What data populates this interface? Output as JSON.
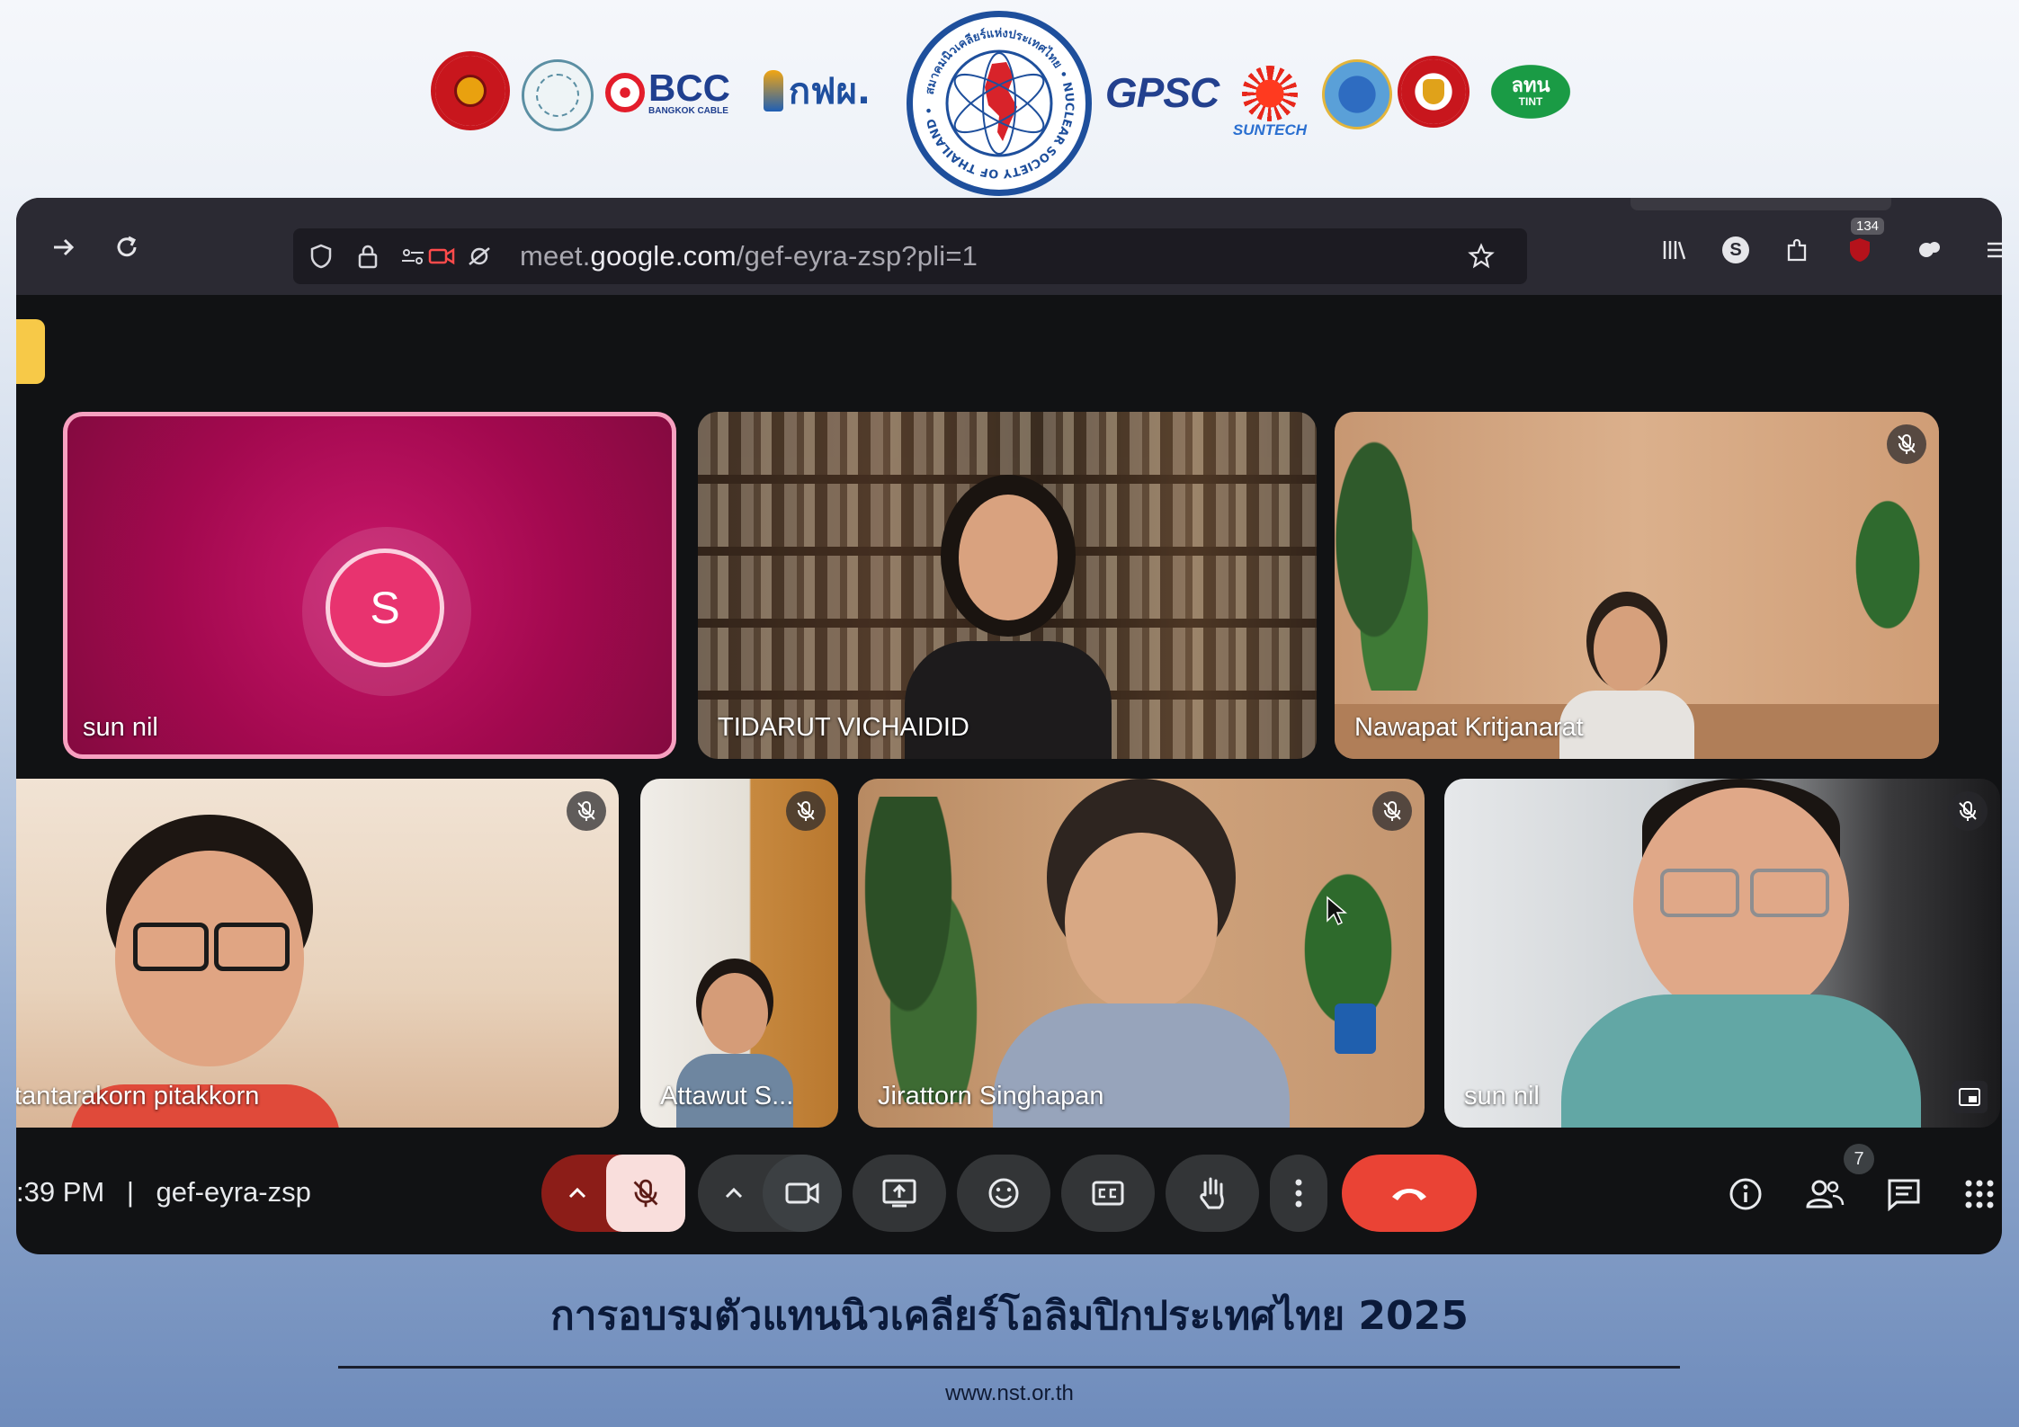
{
  "sponsors": {
    "bcc": "BCC",
    "bcc_sub": "BANGKOK CABLE",
    "egat": "กฟผ.",
    "nst_ring": "สมาคมนิวเคลียร์แห่งประเทศไทย • NUCLEAR SOCIETY OF THAILAND •",
    "gpsc": "GPSC",
    "suntech": "SUNTECH",
    "tint": "ลทน",
    "tint_sub": "TINT"
  },
  "browser": {
    "url_host_prefix": "meet.",
    "url_host": "google.com",
    "url_path": "/gef-eyra-zsp?pli=1",
    "notification_count": "134",
    "profile_initial": "S"
  },
  "meet": {
    "tiles": [
      {
        "name": "sun nil",
        "avatar_initial": "S"
      },
      {
        "name": "TIDARUT VICHAIDID"
      },
      {
        "name": "Nawapat Kritjanarat"
      },
      {
        "name": "tantarakorn pitakkorn"
      },
      {
        "name": "Attawut S..."
      },
      {
        "name": "Jirattorn Singhapan"
      },
      {
        "name": "sun nil"
      }
    ],
    "time": ":39 PM",
    "separator": "|",
    "meeting_code": "gef-eyra-zsp",
    "participant_count": "7"
  },
  "caption": {
    "title": "การอบรมตัวแทนนิวเคลียร์โอลิมปิกประเทศไทย 2025",
    "website": "www.nst.or.th"
  },
  "colors": {
    "end_call": "#ea4335",
    "mic_active_bg": "#f9dedc",
    "avatar_pink": "#e8336f",
    "tile_magenta": "#a3094f"
  }
}
